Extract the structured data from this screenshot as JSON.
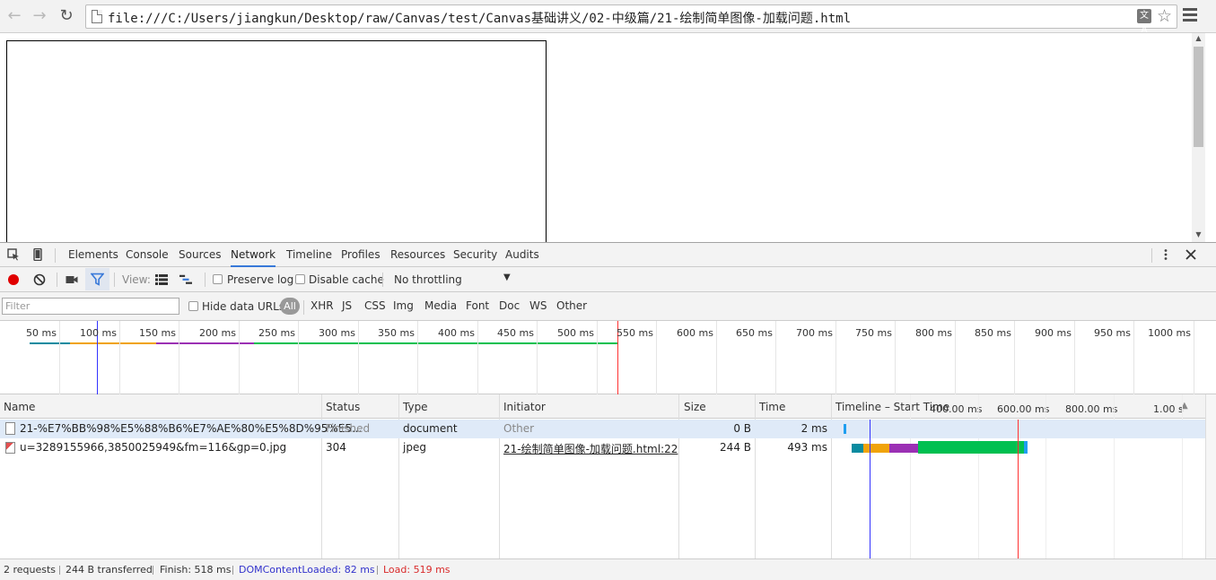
{
  "browser": {
    "url": "file:///C:/Users/jiangkun/Desktop/raw/Canvas/test/Canvas基础讲义/02-中级篇/21-绘制简单图像-加载问题.html",
    "back_icon": "back-arrow-icon",
    "forward_icon": "forward-arrow-icon",
    "reload_icon": "reload-icon",
    "translate_label": "文A",
    "star_icon": "star-icon",
    "menu_icon": "hamburger-menu-icon"
  },
  "devtools": {
    "tabs": [
      "Elements",
      "Console",
      "Sources",
      "Network",
      "Timeline",
      "Profiles",
      "Resources",
      "Security",
      "Audits"
    ],
    "active_tab": "Network",
    "toolbar": {
      "view_label": "View:",
      "preserve_log": "Preserve log",
      "disable_cache": "Disable cache",
      "throttling": "No throttling"
    },
    "filter": {
      "placeholder": "Filter",
      "hide_data_urls": "Hide data URLs",
      "all": "All",
      "types": [
        "XHR",
        "JS",
        "CSS",
        "Img",
        "Media",
        "Font",
        "Doc",
        "WS",
        "Other"
      ]
    },
    "overview": {
      "ticks": [
        "50 ms",
        "100 ms",
        "150 ms",
        "200 ms",
        "250 ms",
        "300 ms",
        "350 ms",
        "400 ms",
        "450 ms",
        "500 ms",
        "550 ms",
        "600 ms",
        "650 ms",
        "700 ms",
        "750 ms",
        "800 ms",
        "850 ms",
        "900 ms",
        "950 ms",
        "1000 ms"
      ]
    },
    "table": {
      "headers": {
        "name": "Name",
        "status": "Status",
        "type": "Type",
        "initiator": "Initiator",
        "size": "Size",
        "time": "Time",
        "timeline": "Timeline – Start Time"
      },
      "timeline_ticks": [
        "400.00 ms",
        "600.00 ms",
        "800.00 ms",
        "1.00 s"
      ],
      "rows": [
        {
          "name": "21-%E7%BB%98%E5%88%B6%E7%AE%80%E5%8D%95%E5...",
          "status": "Finished",
          "type": "document",
          "initiator": "Other",
          "size": "0 B",
          "time": "2 ms"
        },
        {
          "name": "u=3289155966,3850025949&fm=116&gp=0.jpg",
          "status": "304",
          "type": "jpeg",
          "initiator": "21-绘制简单图像-加载问题.html:22",
          "size": "244 B",
          "time": "493 ms"
        }
      ]
    },
    "status_bar": {
      "requests": "2 requests",
      "transferred": "244 B transferred",
      "finish": "Finish: 518 ms",
      "dom_content_loaded": "DOMContentLoaded: 82 ms",
      "load": "Load: 519 ms"
    },
    "colors": {
      "accent": "#3879d9",
      "dcl_line": "#3232ff",
      "load_line": "#ff3232",
      "stalled": "#0a8ba0",
      "dns": "#f0a30a",
      "connect": "#9b30b4",
      "waiting": "#00c050",
      "receiving": "#1f9ef0",
      "record": "#e00000"
    }
  }
}
